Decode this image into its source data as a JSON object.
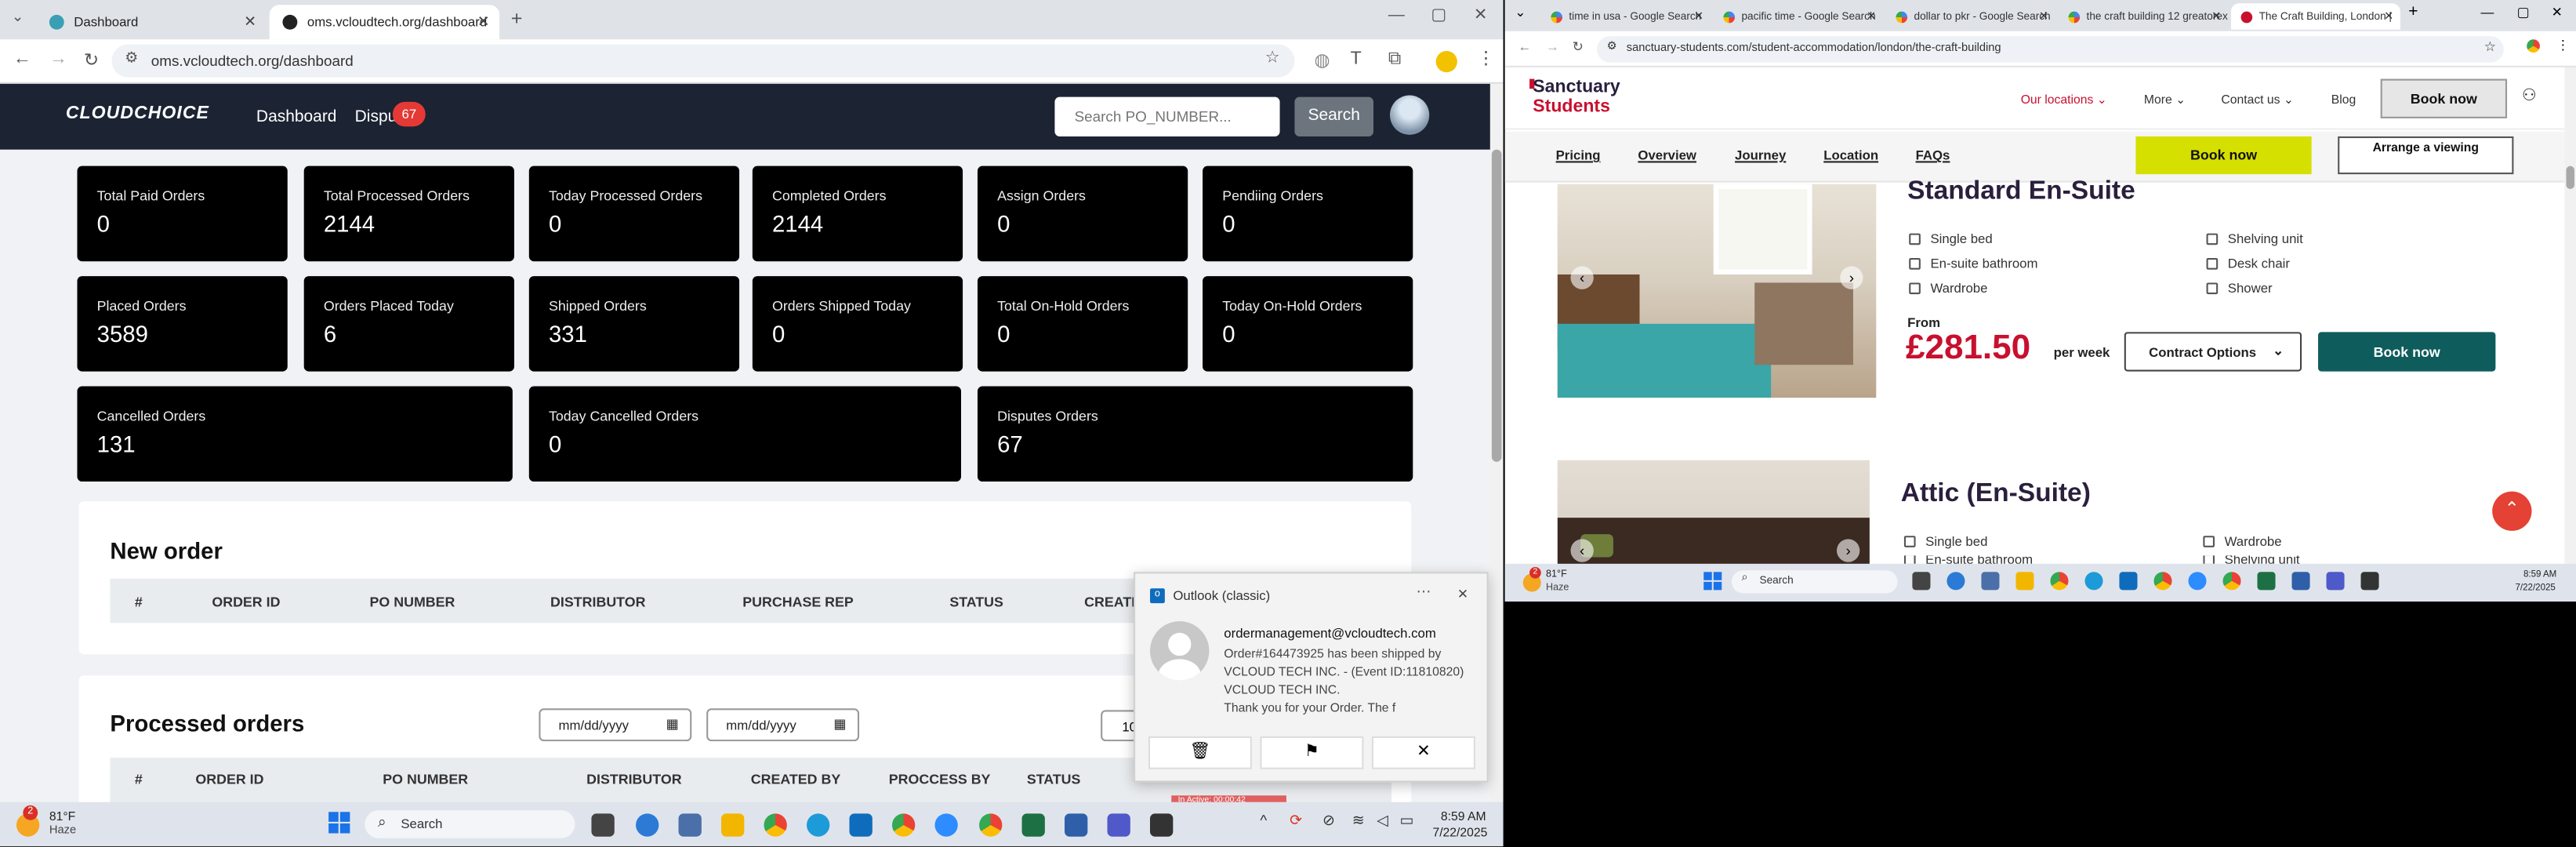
{
  "left_browser": {
    "tabs": [
      {
        "label": "Dashboard"
      },
      {
        "label": "oms.vcloudtech.org/dashboard"
      }
    ],
    "url": "oms.vcloudtech.org/dashboard",
    "app": {
      "logo": "CLOUDCHOICE",
      "nav_dashboard": "Dashboard",
      "nav_disputes": "Dispu",
      "disputes_badge": "67",
      "search_placeholder": "Search PO_NUMBER...",
      "search_button": "Search"
    },
    "stats": [
      {
        "label": "Total Paid Orders",
        "value": "0"
      },
      {
        "label": "Total Processed Orders",
        "value": "2144"
      },
      {
        "label": "Today Processed Orders",
        "value": "0"
      },
      {
        "label": "Completed Orders",
        "value": "2144"
      },
      {
        "label": "Assign Orders",
        "value": "0"
      },
      {
        "label": "Pendiing Orders",
        "value": "0"
      },
      {
        "label": "Placed Orders",
        "value": "3589"
      },
      {
        "label": "Orders Placed Today",
        "value": "6"
      },
      {
        "label": "Shipped Orders",
        "value": "331"
      },
      {
        "label": "Orders Shipped Today",
        "value": "0"
      },
      {
        "label": "Total On-Hold Orders",
        "value": "0"
      },
      {
        "label": "Today On-Hold Orders",
        "value": "0"
      },
      {
        "label": "Cancelled Orders",
        "value": "131"
      },
      {
        "label": "Today Cancelled Orders",
        "value": "0"
      },
      {
        "label": "Disputes Orders",
        "value": "67"
      }
    ],
    "new_order": {
      "title": "New order",
      "columns": [
        "#",
        "ORDER ID",
        "PO NUMBER",
        "DISTRIBUTOR",
        "PURCHASE REP",
        "STATUS",
        "CREATE"
      ]
    },
    "processed_orders": {
      "title": "Processed orders",
      "date_placeholder_1": "mm/dd/yyyy",
      "date_placeholder_2": "mm/dd/yyyy",
      "page_size": "10",
      "columns": [
        "#",
        "ORDER ID",
        "PO NUMBER",
        "DISTRIBUTOR",
        "CREATED BY",
        "PROCCESS BY",
        "STATUS"
      ],
      "row_status_partial": "In Active: 00:00:42"
    }
  },
  "notification": {
    "app": "Outlook (classic)",
    "sender": "ordermanagement@vcloudtech.com",
    "line1": "Order#164473925 has been shipped by",
    "line2": "VCLOUD TECH INC. - (Event ID:11810820)",
    "line3": "VCLOUD TECH INC.",
    "line4": "Thank you for your Order. The f"
  },
  "left_taskbar": {
    "weather_temp": "81°F",
    "weather_desc": "Haze",
    "weather_badge": "2",
    "search": "Search",
    "time": "8:59 AM",
    "date": "7/22/2025"
  },
  "right_browser": {
    "tabs": [
      {
        "label": "time in usa - Google Search"
      },
      {
        "label": "pacific time - Google Search"
      },
      {
        "label": "dollar to pkr - Google Search"
      },
      {
        "label": "the craft building 12 greatorex"
      },
      {
        "label": "The Craft Building, London |"
      }
    ],
    "url": "sanctuary-students.com/student-accommodation/london/the-craft-building",
    "site": {
      "brand_line1": "Sanctuary",
      "brand_line2": "Students",
      "nav": [
        "Our locations",
        "More",
        "Contact us",
        "Blog"
      ],
      "book_now": "Book now",
      "subnav": [
        "Pricing",
        "Overview",
        "Journey",
        "Location",
        "FAQs"
      ],
      "subnav_book": "Book now",
      "arrange": "Arrange a viewing"
    },
    "room1": {
      "title": "Standard En-Suite",
      "features_left": [
        "Single bed",
        "En-suite bathroom",
        "Wardrobe"
      ],
      "features_right": [
        "Shelving unit",
        "Desk chair",
        "Shower"
      ],
      "from": "From",
      "price": "£281.50",
      "per": "per week",
      "contract": "Contract Options",
      "book": "Book now"
    },
    "room2": {
      "title": "Attic (En-Suite)",
      "feature_left": "Single bed",
      "feature_left_2": "En-suite bathroom",
      "feature_right": "Wardrobe",
      "feature_right_2": "Shelving unit"
    }
  },
  "right_taskbar": {
    "weather_temp": "81°F",
    "weather_desc": "Haze",
    "weather_badge": "2",
    "search": "Search",
    "time": "8:59 AM",
    "date": "7/22/2025"
  },
  "colors": {
    "app_header": "#1c2333",
    "card_bg": "#000000",
    "badge": "#e53935",
    "sanctuary_red": "#c8102e",
    "sanctuary_teal": "#0f5c5c",
    "book_yellow": "#d6e000"
  }
}
